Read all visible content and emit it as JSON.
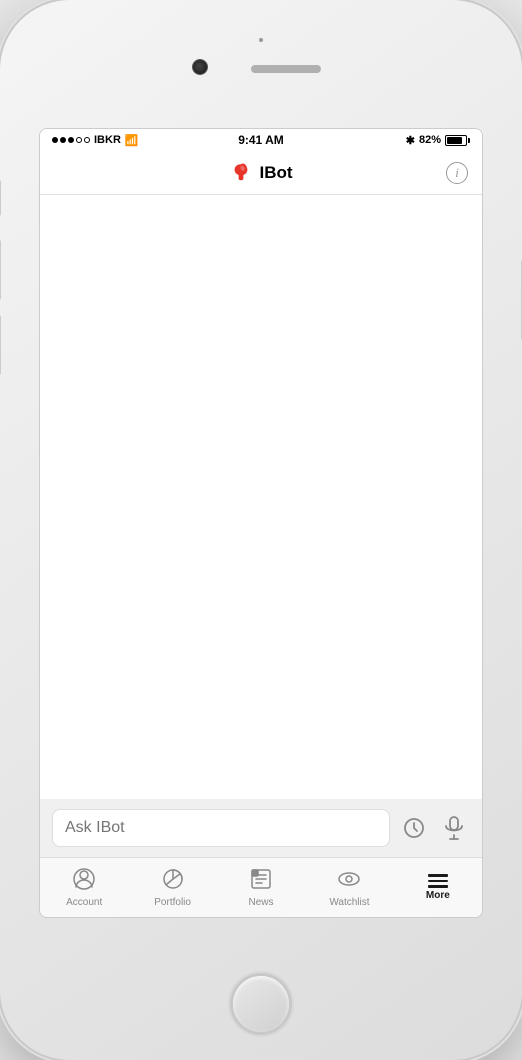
{
  "phone": {
    "status_bar": {
      "carrier": "IBKR",
      "time": "9:41 AM",
      "battery_percent": "82%",
      "signal_dots": [
        "filled",
        "filled",
        "filled",
        "empty",
        "empty"
      ]
    },
    "nav": {
      "title": "IBot",
      "info_label": "i"
    },
    "input": {
      "placeholder": "Ask IBot"
    },
    "tabs": [
      {
        "id": "account",
        "label": "Account",
        "icon": "account"
      },
      {
        "id": "portfolio",
        "label": "Portfolio",
        "icon": "portfolio"
      },
      {
        "id": "news",
        "label": "News",
        "icon": "news"
      },
      {
        "id": "watchlist",
        "label": "Watchlist",
        "icon": "watchlist"
      },
      {
        "id": "more",
        "label": "More",
        "icon": "more",
        "active": true
      }
    ]
  }
}
